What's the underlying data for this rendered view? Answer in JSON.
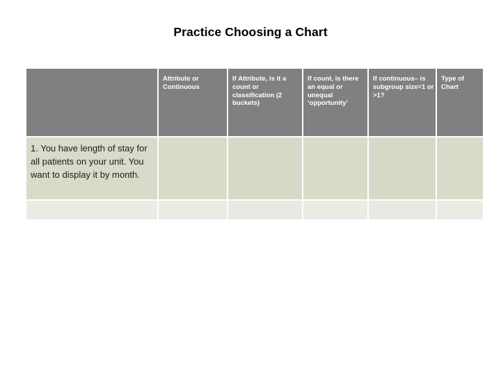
{
  "slide": {
    "title": "Practice Choosing a Chart"
  },
  "table": {
    "headers": [
      "",
      "Attribute or\nContinuous",
      "If Attribute, is it\na count\nor classification\n(2 buckets)",
      "If count, is\nthere an\nequal or\nunequal\n‘opportunity’",
      "If continuous–\nis subgroup\nsize=1 or >1?",
      "Type of\nChart"
    ],
    "rows": [
      {
        "cells": [
          "1. You have length of stay for all patients on your unit. You want to display it by month.",
          "",
          "",
          "",
          "",
          ""
        ]
      },
      {
        "cells": [
          "",
          "",
          "",
          "",
          "",
          ""
        ]
      }
    ]
  },
  "colors": {
    "header_background": "#808080",
    "header_text": "#ffffff",
    "row1_background": "#d7dcc9",
    "row2_background": "#eaece4",
    "divider": "#ffffff",
    "title_text": "#000000"
  }
}
